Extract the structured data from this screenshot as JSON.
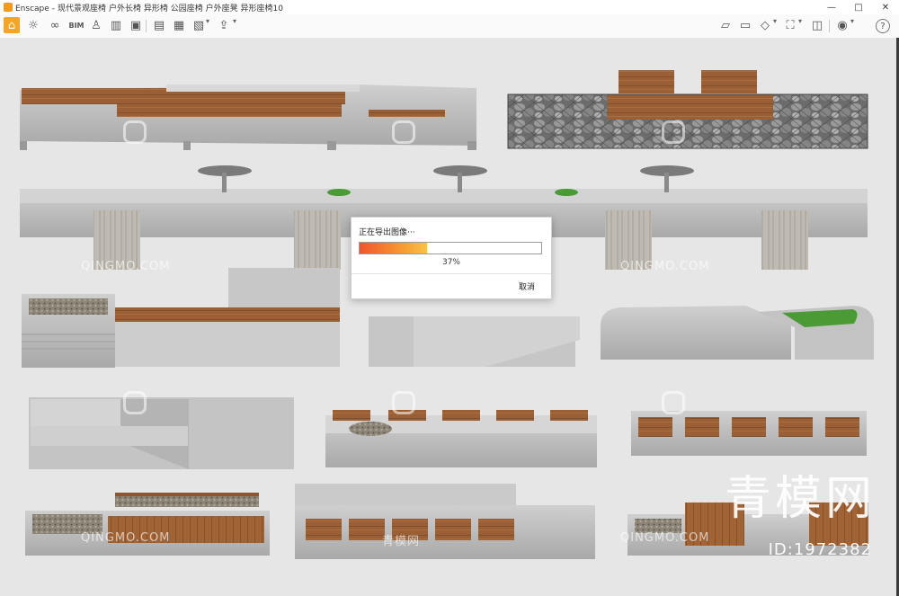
{
  "window": {
    "app_name": "Enscape",
    "title_parts": [
      "现代景观座椅",
      "户外长椅",
      "异形椅",
      "公园座椅",
      "户外座凳",
      "异形座椅10"
    ],
    "controls": [
      "—",
      "□",
      "✕"
    ]
  },
  "toolbar": {
    "left_icons": [
      "home-icon",
      "sun-icon",
      "glasses-icon",
      "bim-icon",
      "character-icon",
      "asset-icon",
      "building-icon",
      "film-icon",
      "image-export-icon",
      "panorama-export-icon",
      "batch-export-icon",
      "upload-icon"
    ],
    "bim_label": "BIM",
    "right_icons": [
      "map-icon",
      "monitor-icon",
      "cube-icon",
      "walk-icon",
      "vr-icon",
      "eye-icon",
      "help-icon"
    ]
  },
  "watermarks": {
    "brand_en": "QINGMO.COM",
    "brand_cn": "青模网",
    "big_cn": "青模网",
    "id_label": "ID:1972382"
  },
  "dialog": {
    "title": "正在导出图像···",
    "progress": 0.37,
    "percent_label": "37%",
    "cancel_label": "取消"
  },
  "colors": {
    "accent": "#f5a524",
    "progress_start": "#f0552a",
    "progress_end": "#f9c24a",
    "concrete": "#bdbdbd",
    "wood": "#9a5f35",
    "grass": "#4a9a35"
  }
}
